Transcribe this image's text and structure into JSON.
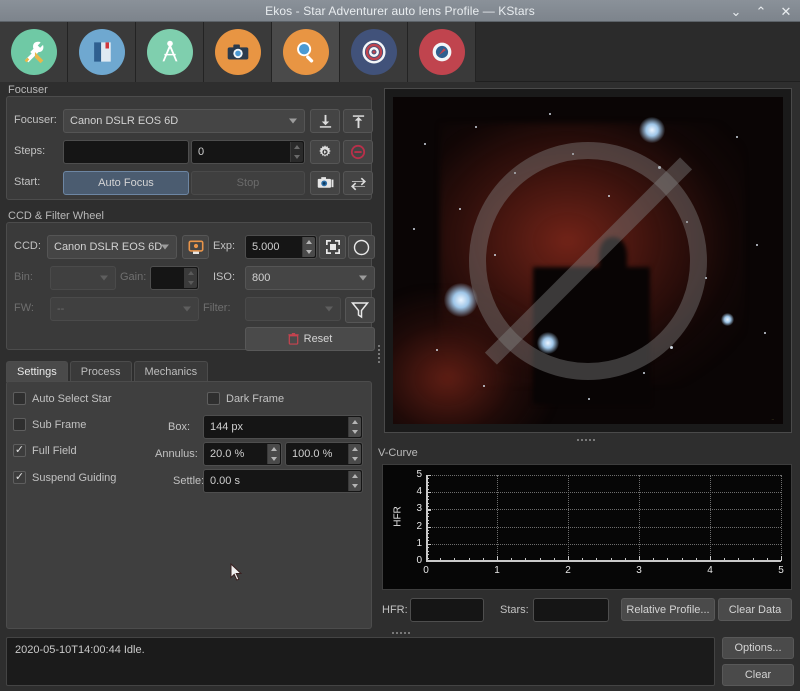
{
  "window": {
    "title": "Ekos - Star Adventurer auto lens Profile — KStars",
    "minimize": "⌄",
    "maximize": "⌃",
    "close": "✕"
  },
  "iconbar": {
    "tabs": [
      {
        "name": "setup",
        "icon": "tools-icon",
        "bg": "#6fc9a5",
        "active": false
      },
      {
        "name": "logs",
        "icon": "book-icon",
        "bg": "#6fa8d0",
        "active": false
      },
      {
        "name": "mount",
        "icon": "tripod-icon",
        "bg": "#7fcfae",
        "active": false
      },
      {
        "name": "capture",
        "icon": "camera-icon",
        "bg": "#e89543",
        "active": false
      },
      {
        "name": "focus",
        "icon": "magnifier-icon",
        "bg": "#e89543",
        "active": true
      },
      {
        "name": "align",
        "icon": "target-icon",
        "bg": "#41527a",
        "active": false
      },
      {
        "name": "guide",
        "icon": "guidestar-icon",
        "bg": "#c0444e",
        "active": false
      }
    ]
  },
  "focuser": {
    "legend": "Focuser",
    "device_label": "Focuser:",
    "device_value": "Canon DSLR EOS 6D",
    "steps_label": "Steps:",
    "steps_value": "",
    "steps_position_value": "0",
    "start_label": "Start:",
    "auto_focus_label": "Auto Focus",
    "stop_label": "Stop",
    "icons": {
      "focus_in": "arrow-down-icon",
      "focus_out": "arrow-up-icon",
      "settings": "gear-icon",
      "abort": "abort-circle-icon",
      "capture": "capture-camera-icon",
      "loop": "loop-icon"
    }
  },
  "ccd": {
    "legend": "CCD & Filter Wheel",
    "ccd_label": "CCD:",
    "ccd_value": "Canon DSLR EOS 6D",
    "exp_label": "Exp:",
    "exp_value": "5.000",
    "bin_label": "Bin:",
    "bin_value": "",
    "gain_label": "Gain:",
    "gain_value": "",
    "iso_label": "ISO:",
    "iso_value": "800",
    "fw_label": "FW:",
    "fw_value": "--",
    "filter_label": "Filter:",
    "filter_value": "",
    "reset_label": "Reset",
    "icons": {
      "ccd_settings": "ccd-settings-icon",
      "frame": "frame-crop-icon",
      "toggle_full": "toggle-fullframe-icon",
      "filter": "filter-funnel-icon",
      "reset": "trash-icon"
    }
  },
  "settings_panel": {
    "tabs": [
      {
        "label": "Settings",
        "active": true
      },
      {
        "label": "Process",
        "active": false
      },
      {
        "label": "Mechanics",
        "active": false
      }
    ],
    "auto_select_star": {
      "label": "Auto Select Star",
      "checked": false
    },
    "dark_frame": {
      "label": "Dark Frame",
      "checked": false
    },
    "sub_frame": {
      "label": "Sub Frame",
      "checked": false
    },
    "full_field": {
      "label": "Full Field",
      "checked": true
    },
    "suspend_guiding": {
      "label": "Suspend Guiding",
      "checked": true
    },
    "box_label": "Box:",
    "box_value": "144 px",
    "annulus_label": "Annulus:",
    "annulus_inner": "20.0 %",
    "annulus_outer": "100.0 %",
    "settle_label": "Settle:",
    "settle_value": "0.00 s"
  },
  "vcurve": {
    "title": "V-Curve",
    "hfr_label": "HFR:",
    "hfr_value": "",
    "stars_label": "Stars:",
    "stars_value": "",
    "relative_profile_label": "Relative Profile...",
    "clear_data_label": "Clear Data"
  },
  "chart_data": {
    "type": "line",
    "title": "V-Curve",
    "xlabel": "",
    "ylabel": "HFR",
    "xlim": [
      0,
      5
    ],
    "ylim": [
      0,
      5
    ],
    "xticks": [
      "0",
      "1",
      "2",
      "3",
      "4",
      "5"
    ],
    "yticks": [
      "0",
      "1",
      "2",
      "3",
      "4",
      "5"
    ],
    "grid": true,
    "legend": false,
    "series": [
      {
        "name": "HFR",
        "x": [],
        "y": []
      }
    ]
  },
  "statusbar": {
    "log_text": "2020-05-10T14:00:44 Idle.",
    "options_label": "Options...",
    "clear_label": "Clear"
  }
}
